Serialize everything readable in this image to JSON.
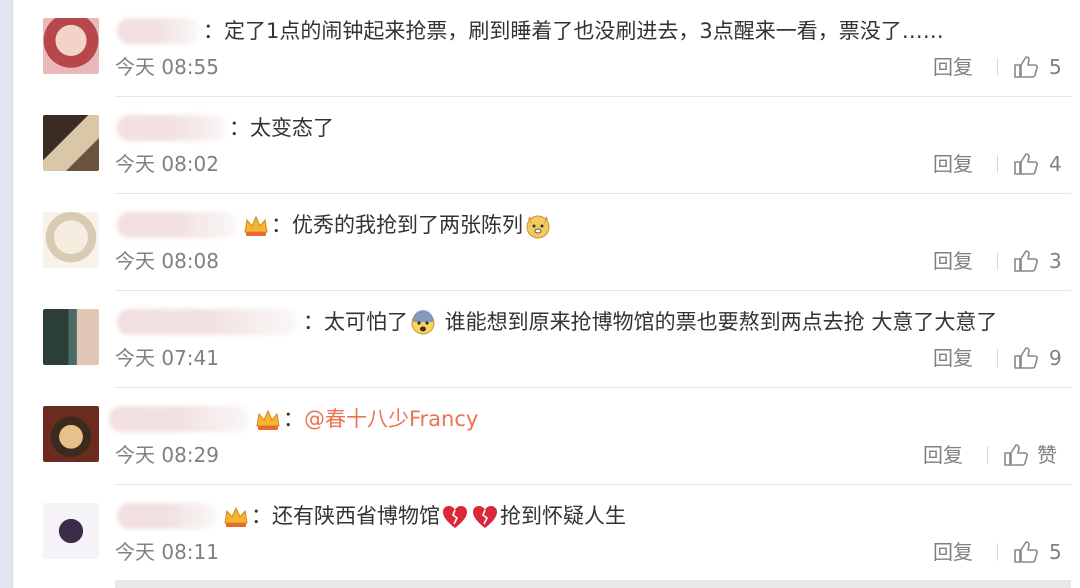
{
  "comments": [
    {
      "text": "：定了1点的闹钟起来抢票，刷到睡着了也没刷进去，3点醒来一看，票没了……",
      "time": "今天 08:55",
      "reply_label": "回复",
      "likes": "5"
    },
    {
      "text": "：太变态了",
      "time": "今天 08:02",
      "reply_label": "回复",
      "likes": "4"
    },
    {
      "text": "：优秀的我抢到了两张陈列",
      "time": "今天 08:08",
      "reply_label": "回复",
      "likes": "3"
    },
    {
      "text_a": "：太可怕了",
      "text_b": "  谁能想到原来抢博物馆的票也要熬到两点去抢 大意了大意了",
      "time": "今天 07:41",
      "reply_label": "回复",
      "likes": "9"
    },
    {
      "text_prefix": "：",
      "mention": "@春十八少Francy",
      "time": "今天 08:29",
      "reply_label": "回复",
      "likes": "赞"
    },
    {
      "text_a": "：还有陕西省博物馆",
      "text_b": "抢到怀疑人生",
      "time": "今天 08:11",
      "reply_label": "回复",
      "likes": "5"
    }
  ],
  "icons": {
    "like": "thumbs-up-icon",
    "vip_badge": "crown-badge-icon",
    "emoji_dog": "dog-face-emoji",
    "emoji_fear": "fearful-face-emoji",
    "emoji_broken_heart": "broken-heart-emoji"
  },
  "colors": {
    "mention": "#eb7350",
    "meta": "#808080",
    "text": "#333333"
  }
}
